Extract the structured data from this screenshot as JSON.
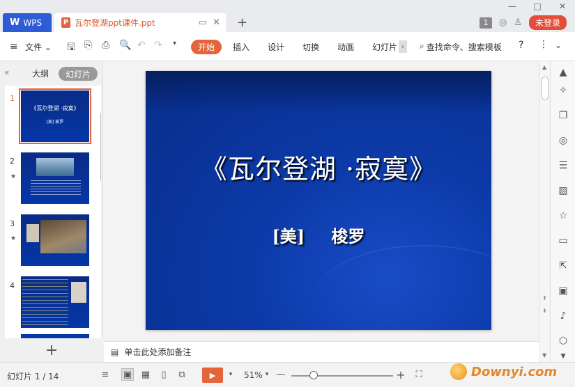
{
  "titlebar": {
    "app_tab": "WPS",
    "doc_tab": "瓦尔登湖ppt课件.ppt",
    "page_count_badge": "1",
    "login": "未登录"
  },
  "menu": {
    "file": "文件",
    "tabs": [
      "开始",
      "插入",
      "设计",
      "切换",
      "动画",
      "幻灯片"
    ],
    "search": "查找命令、搜索模板",
    "help": "?"
  },
  "left_panel": {
    "outline_tab": "大纲",
    "slides_tab": "幻灯片",
    "thumbnails": [
      {
        "num": "1",
        "title": "《瓦尔登湖 ·寂寞》",
        "sub": "[美]    梭罗"
      },
      {
        "num": "2"
      },
      {
        "num": "3"
      },
      {
        "num": "4"
      }
    ],
    "add": "+"
  },
  "slide": {
    "title": "《瓦尔登湖 ·寂寞》",
    "subtitle": "[美] 梭罗"
  },
  "notes": {
    "placeholder": "单击此处添加备注"
  },
  "status": {
    "slide_counter": "幻灯片 1 / 14",
    "zoom": "51%",
    "watermark": "Downyi.com"
  },
  "icons": {
    "colors": {
      "accent": "#e4643b",
      "wps_blue": "#2e5bd6",
      "slide_blue": "#0c3aa8",
      "login_red": "#e44d3a"
    }
  }
}
